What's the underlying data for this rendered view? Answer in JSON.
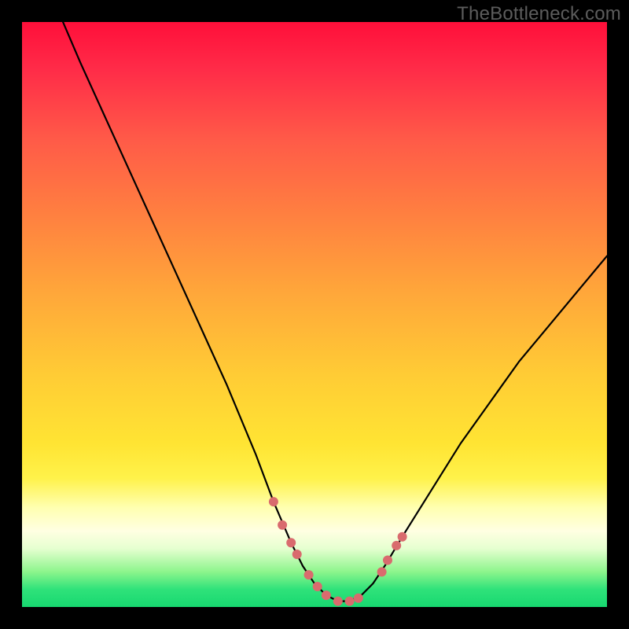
{
  "watermark": "TheBottleneck.com",
  "colors": {
    "frame": "#000000",
    "curve_stroke": "#000000",
    "marker_fill": "#d96b6e",
    "gradient_top": "#ff0f3a",
    "gradient_bottom": "#17d870"
  },
  "chart_data": {
    "type": "line",
    "title": "",
    "xlabel": "",
    "ylabel": "",
    "xlim": [
      0,
      100
    ],
    "ylim": [
      0,
      100
    ],
    "grid": false,
    "series": [
      {
        "name": "bottleneck-curve",
        "x": [
          7,
          10,
          15,
          20,
          25,
          30,
          35,
          40,
          43,
          46,
          48,
          50,
          52,
          54,
          56,
          58,
          60,
          62,
          65,
          70,
          75,
          80,
          85,
          90,
          95,
          100
        ],
        "y": [
          100,
          93,
          82,
          71,
          60,
          49,
          38,
          26,
          18,
          11,
          7,
          4,
          2,
          1,
          1,
          2,
          4,
          7,
          12,
          20,
          28,
          35,
          42,
          48,
          54,
          60
        ]
      }
    ],
    "markers": {
      "name": "highlight-points",
      "x": [
        43.0,
        44.5,
        46.0,
        47.0,
        49.0,
        50.5,
        52.0,
        54.0,
        56.0,
        57.5,
        61.5,
        62.5,
        64.0,
        65.0
      ],
      "y": [
        18.0,
        14.0,
        11.0,
        9.0,
        5.5,
        3.5,
        2.0,
        1.0,
        1.0,
        1.5,
        6.0,
        8.0,
        10.5,
        12.0
      ],
      "radius": 6
    }
  }
}
